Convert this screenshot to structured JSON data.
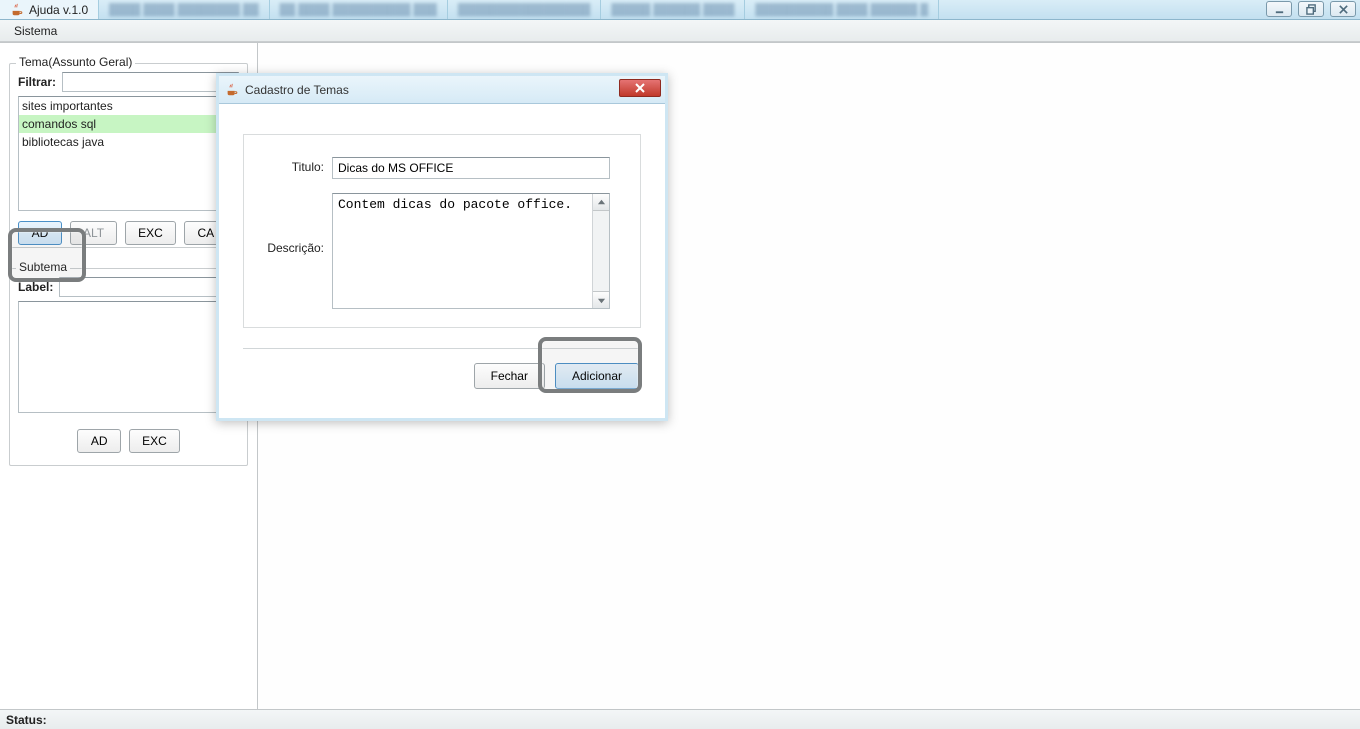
{
  "taskbar": {
    "app_title": "Ajuda v.1.0"
  },
  "menubar": {
    "sistema": "Sistema"
  },
  "sidebar": {
    "tema": {
      "legend": "Tema(Assunto Geral)",
      "filter_label": "Filtrar:",
      "filter_value": "",
      "items": [
        "sites importantes",
        "comandos sql",
        "bibliotecas java"
      ],
      "selected_index": 1,
      "buttons": {
        "ad": "AD",
        "alt": "ALT",
        "exc": "EXC",
        "ca": "CA"
      }
    },
    "subtema": {
      "legend": "Subtema",
      "label_label": "Label:",
      "label_value": "",
      "buttons": {
        "ad": "AD",
        "exc": "EXC"
      }
    }
  },
  "dialog": {
    "title": "Cadastro de Temas",
    "fields": {
      "titulo_label": "Titulo:",
      "titulo_value": "Dicas do MS OFFICE",
      "descricao_label": "Descrição:",
      "descricao_value": "Contem dicas do pacote office."
    },
    "buttons": {
      "fechar": "Fechar",
      "adicionar": "Adicionar"
    }
  },
  "statusbar": {
    "label": "Status:"
  }
}
